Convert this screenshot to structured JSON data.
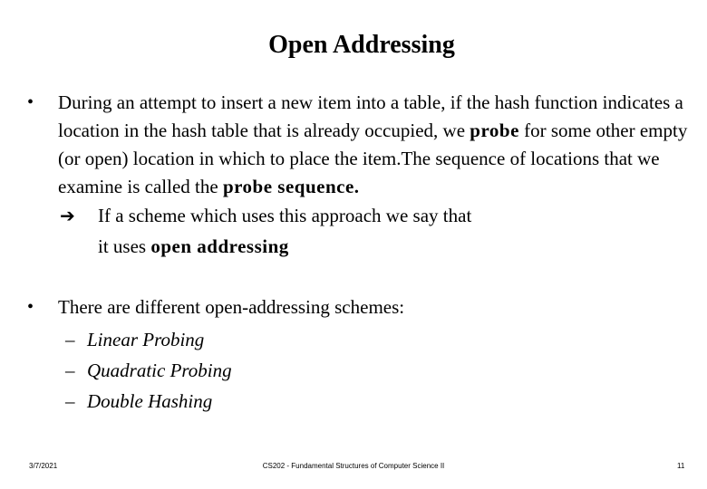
{
  "slide": {
    "title": "Open Addressing",
    "bullet1": {
      "marker": "•",
      "text_before_probe": "During an attempt to insert a new item into a table, if the hash function indicates a location in the hash table that is already occupied, we ",
      "bold_probe": "probe",
      "text_middle": " for some other empty (or open) location in which to place the item.The sequence of locations that we examine is called the ",
      "bold_sequence": "probe sequence.",
      "arrow_icon": "right-arrow-icon",
      "arrow_glyph": "➔",
      "arrow_text": "If a scheme which uses this approach we say that",
      "arrow_text2_before": "it uses ",
      "arrow_text2_bold": "open addressing"
    },
    "bullet2": {
      "marker": "•",
      "text": "There are different open-addressing schemes:",
      "dash": "–",
      "items": [
        "Linear Probing",
        "Quadratic Probing",
        "Double Hashing"
      ]
    }
  },
  "footer": {
    "date": "3/7/2021",
    "course": "CS202 - Fundamental Structures of Computer Science II",
    "page": "11"
  }
}
